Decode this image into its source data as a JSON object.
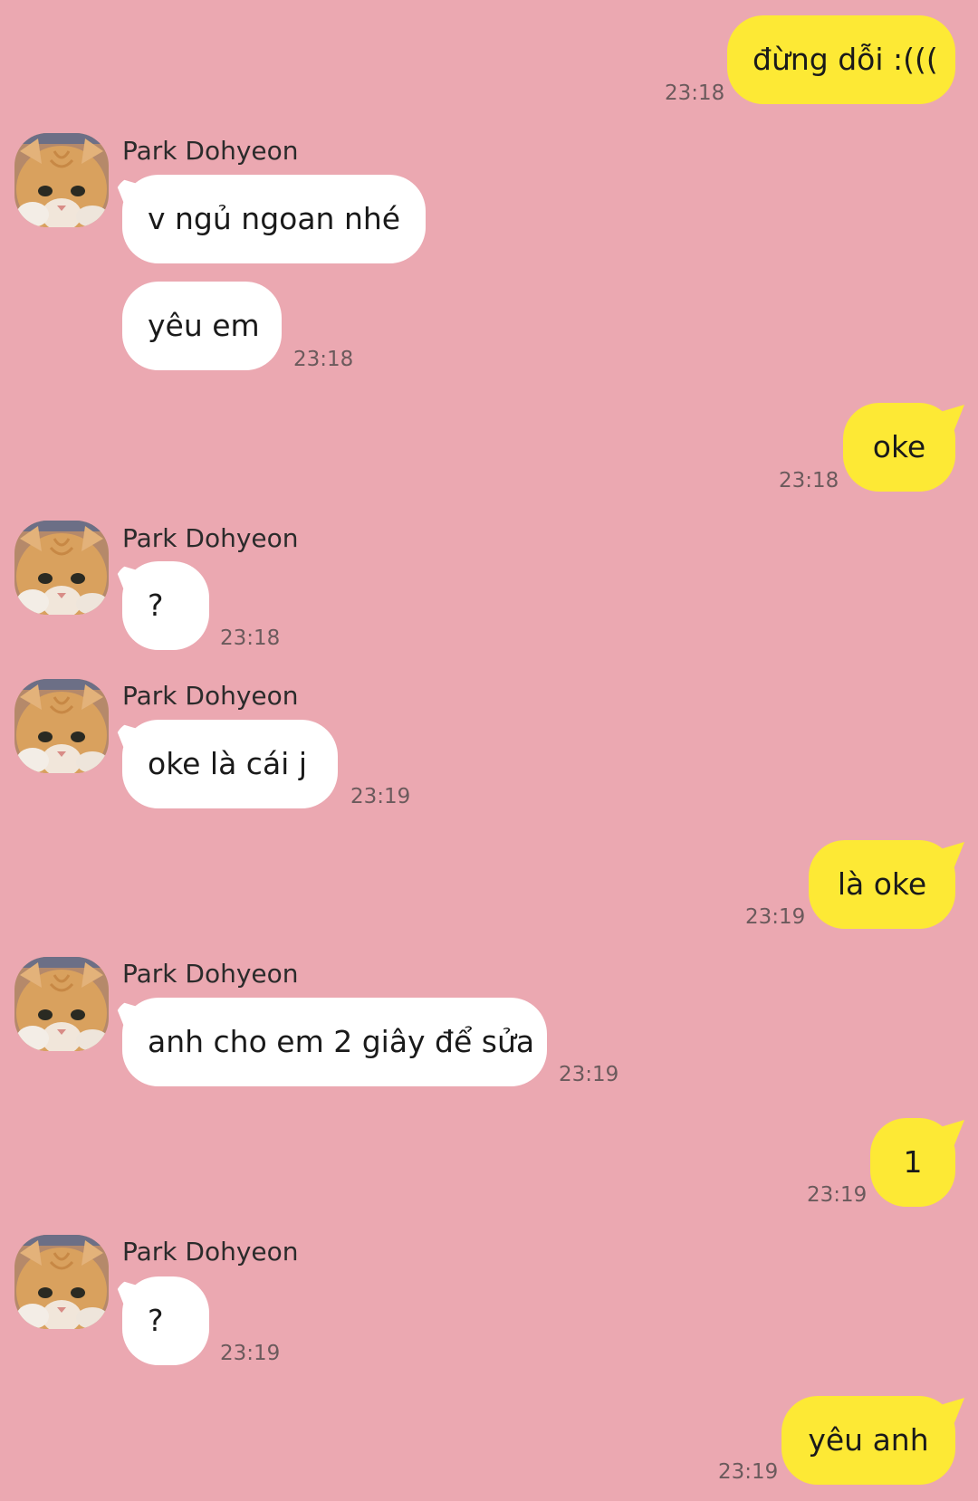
{
  "conversation": {
    "contact_name": "Park Dohyeon",
    "messages": [
      {
        "from": "me",
        "text": "đừng dỗi :(((",
        "time": "23:18"
      },
      {
        "from": "them",
        "text": "v ngủ ngoan nhé",
        "time": ""
      },
      {
        "from": "them",
        "text": "yêu em",
        "time": "23:18"
      },
      {
        "from": "me",
        "text": "oke",
        "time": "23:18"
      },
      {
        "from": "them",
        "text": "?",
        "time": "23:18"
      },
      {
        "from": "them",
        "text": "oke là cái j",
        "time": "23:19"
      },
      {
        "from": "me",
        "text": "là oke",
        "time": "23:19"
      },
      {
        "from": "them",
        "text": "anh cho em 2 giây để sửa",
        "time": "23:19"
      },
      {
        "from": "me",
        "text": "1",
        "time": "23:19"
      },
      {
        "from": "them",
        "text": "?",
        "time": "23:19"
      },
      {
        "from": "me",
        "text": "yêu anh",
        "time": "23:19"
      }
    ]
  },
  "colors": {
    "background": "#EBA8B1",
    "outgoing_bubble": "#FDE935",
    "incoming_bubble": "#FFFFFF"
  },
  "icons": {
    "avatar": "cat-avatar-icon"
  }
}
